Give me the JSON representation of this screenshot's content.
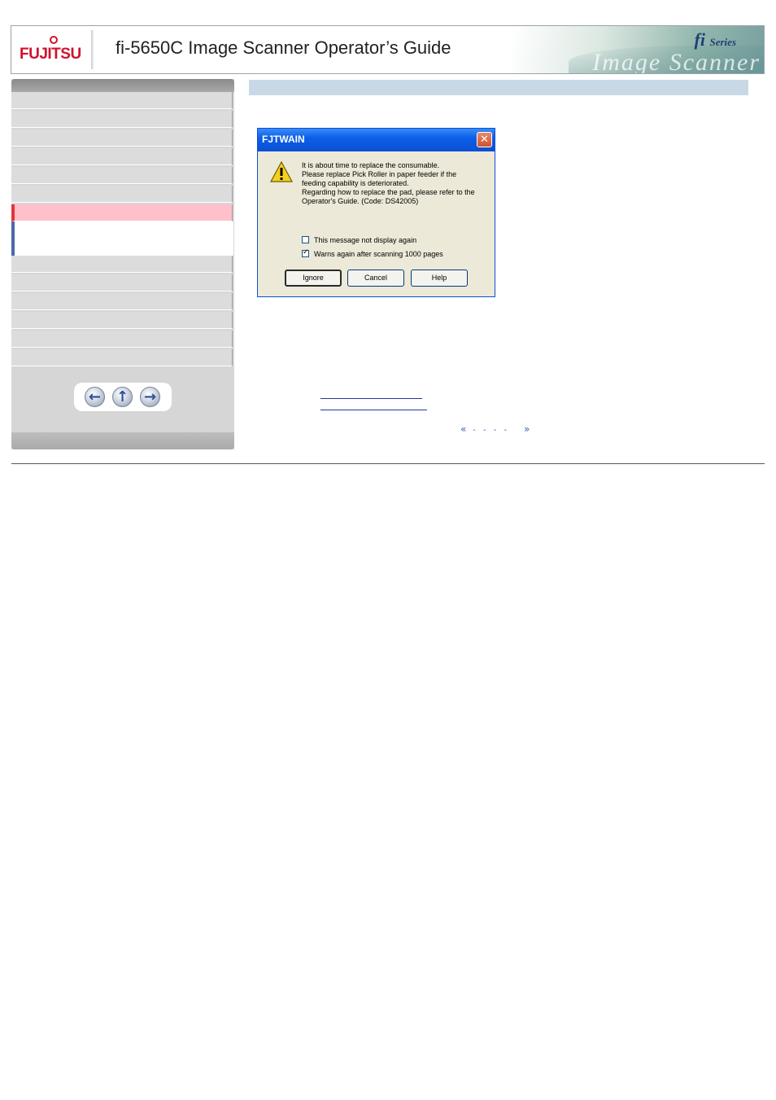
{
  "header": {
    "logo_text": "FUJITSU",
    "title": "fi-5650C Image Scanner Operator’s Guide",
    "series_fi": "fi",
    "series_word": "Series",
    "watermark": "Image Scanner"
  },
  "sidebar": {
    "nav_count": 11,
    "active_index": 6,
    "buttons": {
      "back_icon": "left-arrow-icon",
      "up_icon": "up-arrow-icon",
      "forward_icon": "right-arrow-icon"
    }
  },
  "dialog": {
    "title": "FJTWAIN",
    "message_lines": [
      "It is about time to replace the consumable.",
      "Please replace Pick Roller in paper feeder if the",
      "feeding capability is deteriorated.",
      "Regarding how to replace the pad, please refer to the",
      "Operator's Guide. (Code: DS42005)"
    ],
    "checkbox1": {
      "label": "This message not display again",
      "checked": false
    },
    "checkbox2": {
      "label": "Warns again after scanning 1000 pages",
      "checked": true
    },
    "buttons": {
      "ignore": "Ignore",
      "cancel": "Cancel",
      "help": "Help"
    }
  },
  "pager": {
    "prev": "«",
    "next": "»",
    "dashes": "- - - -"
  },
  "colors": {
    "brand_red": "#d0112b",
    "active_nav": "#ffc0cb",
    "xp_title_blue": "#0d5fe8",
    "content_header": "#c8d8e6"
  }
}
